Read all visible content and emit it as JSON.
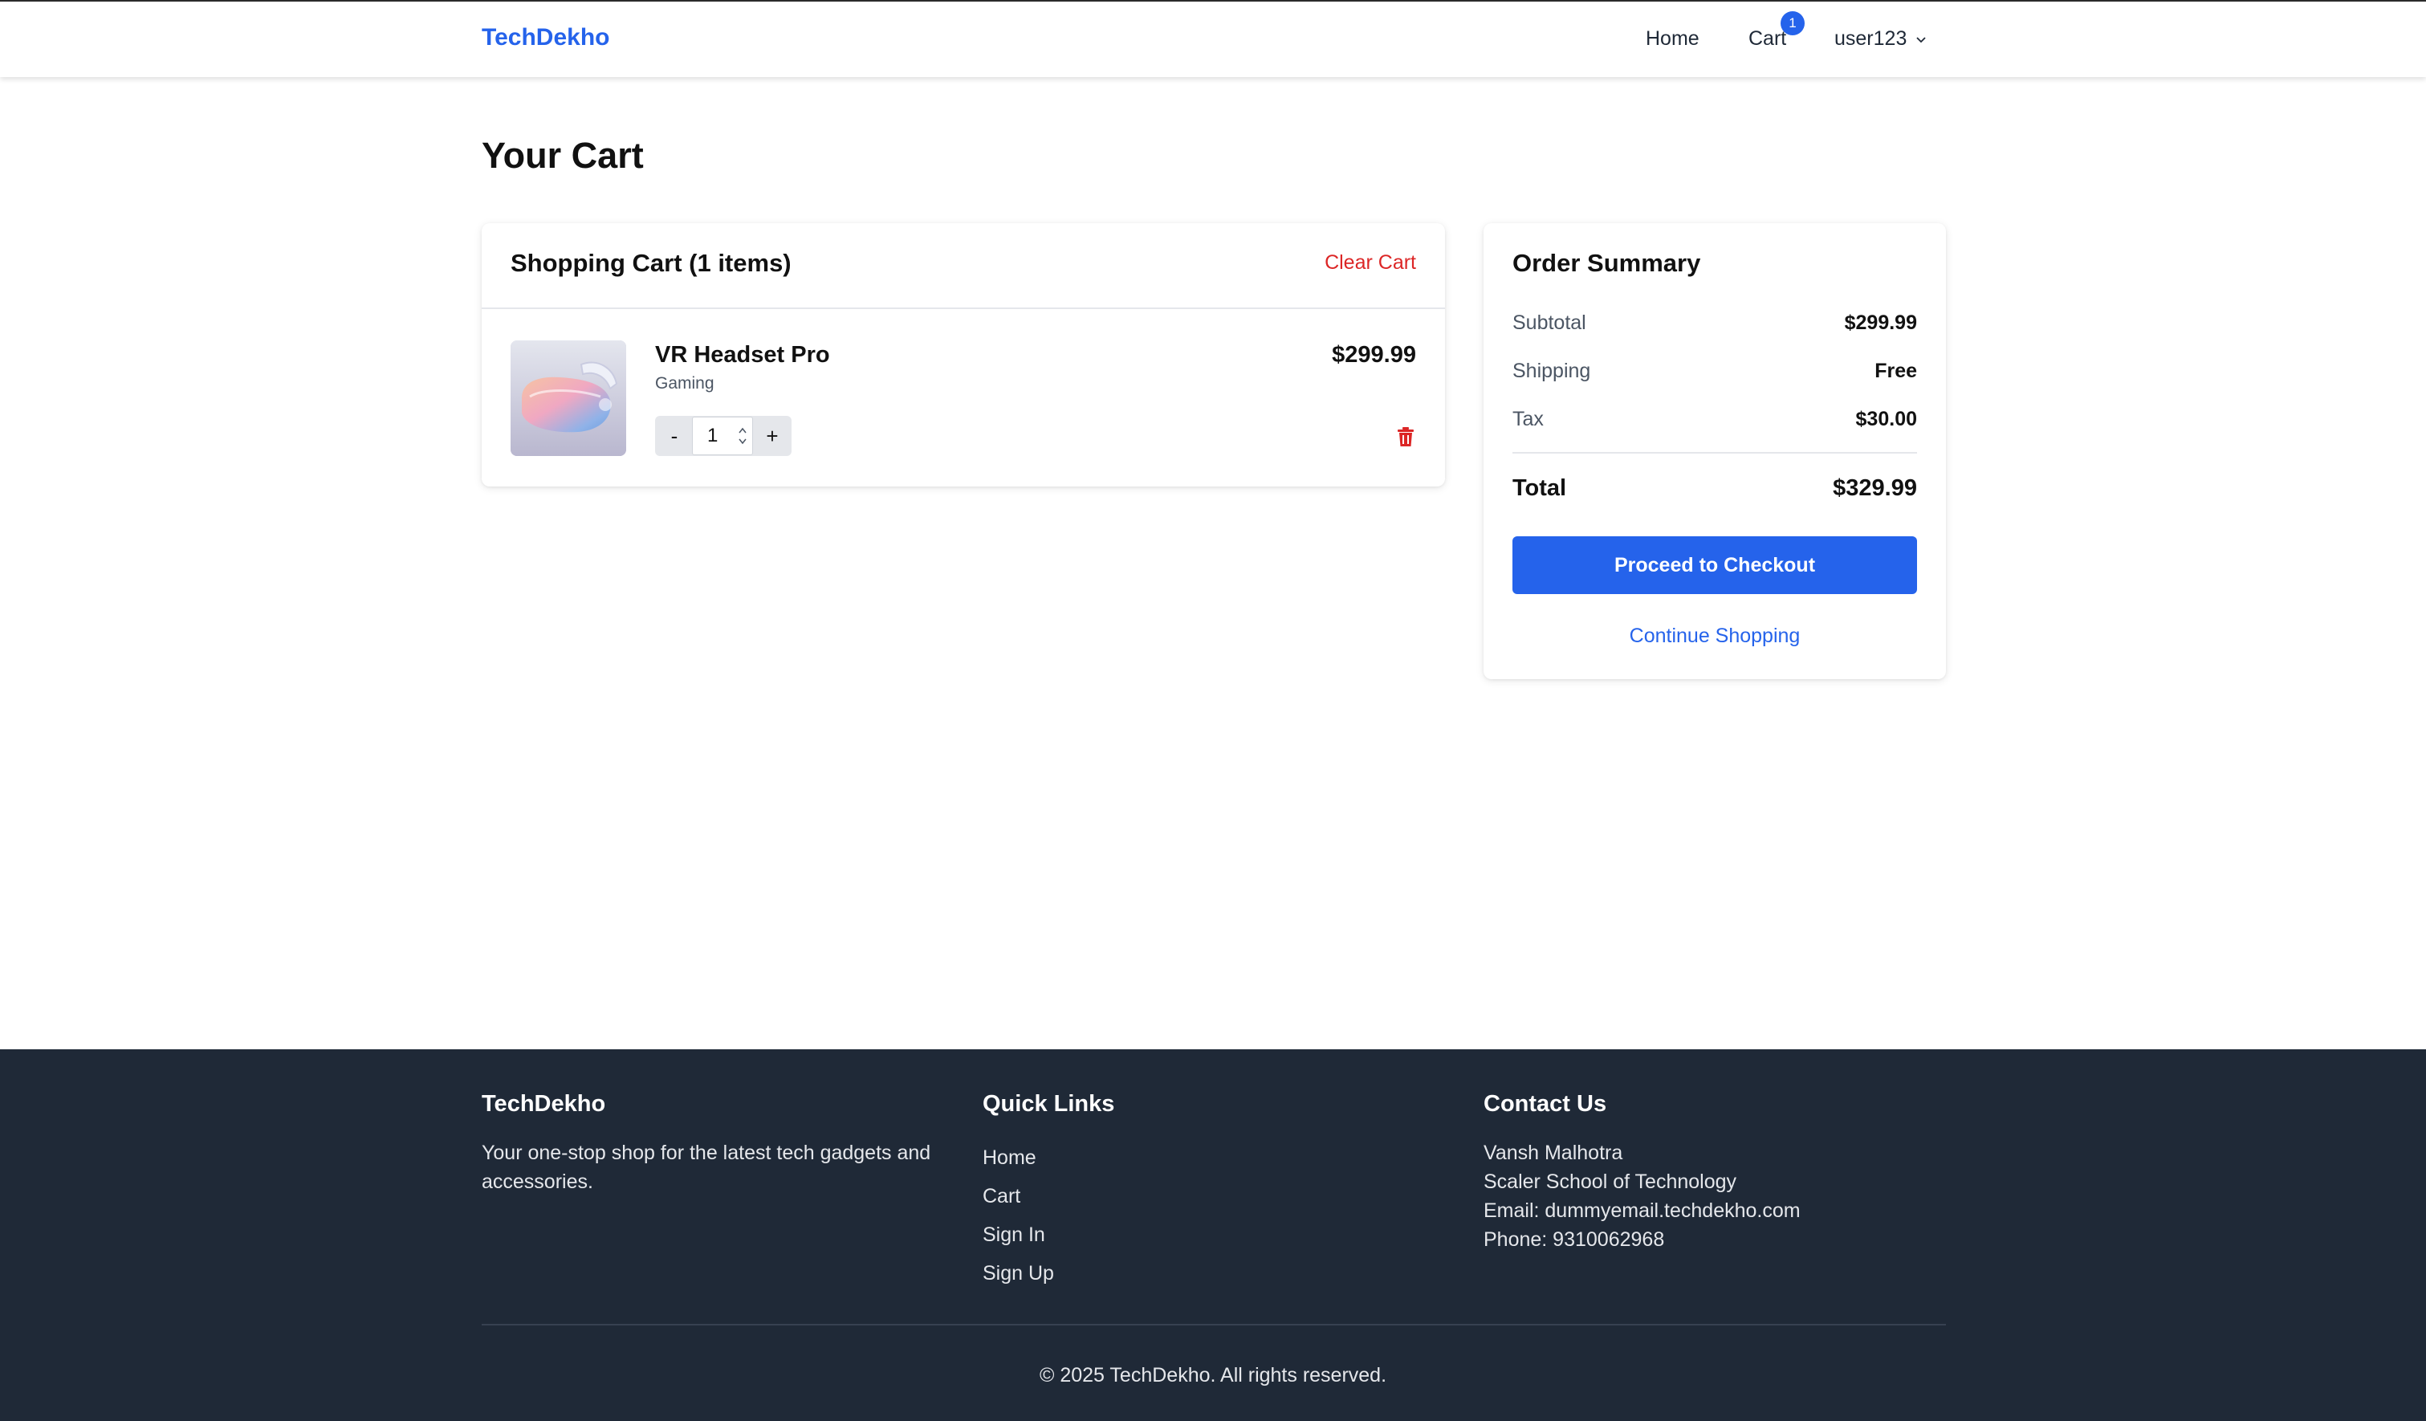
{
  "navbar": {
    "brand": "TechDekho",
    "links": {
      "home": "Home",
      "cart": "Cart"
    },
    "cart_count": "1",
    "user": "user123"
  },
  "page": {
    "title": "Your Cart"
  },
  "cart": {
    "heading": "Shopping Cart (1 items)",
    "clear_label": "Clear Cart",
    "items": [
      {
        "name": "VR Headset Pro",
        "category": "Gaming",
        "price": "$299.99",
        "quantity": "1",
        "minus_label": "-",
        "plus_label": "+"
      }
    ]
  },
  "summary": {
    "title": "Order Summary",
    "rows": [
      {
        "label": "Subtotal",
        "value": "$299.99"
      },
      {
        "label": "Shipping",
        "value": "Free"
      },
      {
        "label": "Tax",
        "value": "$30.00"
      }
    ],
    "total_label": "Total",
    "total_value": "$329.99",
    "checkout_label": "Proceed to Checkout",
    "continue_label": "Continue Shopping"
  },
  "footer": {
    "about": {
      "heading": "TechDekho",
      "text": "Your one-stop shop for the latest tech gadgets and accessories."
    },
    "quick_links": {
      "heading": "Quick Links",
      "items": [
        "Home",
        "Cart",
        "Sign In",
        "Sign Up"
      ]
    },
    "contact": {
      "heading": "Contact Us",
      "lines": [
        "Vansh Malhotra",
        "Scaler School of Technology",
        "Email: dummyemail.techdekho.com",
        "Phone: 9310062968"
      ]
    },
    "copyright": "© 2025 TechDekho. All rights reserved."
  },
  "colors": {
    "accent": "#2563eb",
    "danger": "#dc2626",
    "footer_bg": "#1f2937"
  },
  "icons": {
    "user_menu": "chevron-down-icon",
    "remove_item": "trash-icon",
    "quantity_spinner": "spinner-icon"
  }
}
